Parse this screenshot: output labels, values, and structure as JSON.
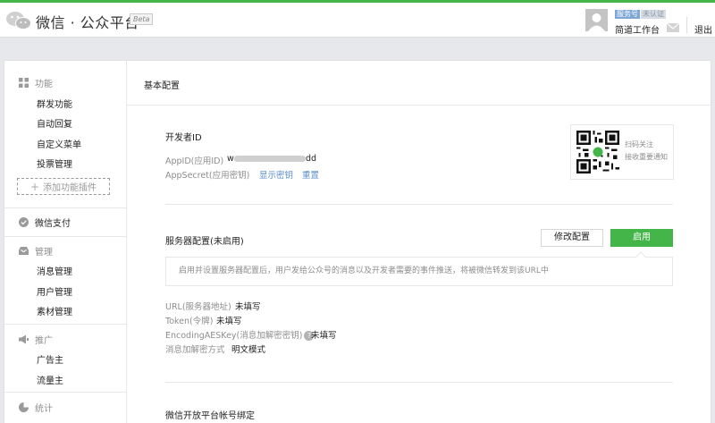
{
  "header": {
    "logo_text": "微信 · 公众平台",
    "beta": "Beta",
    "tag_type": "服务号",
    "tag_status": "未认证",
    "account_name": "简道工作台",
    "logout": "退出"
  },
  "sidebar": {
    "sections": {
      "function": {
        "title": "功能",
        "items": [
          "群发功能",
          "自动回复",
          "自定义菜单",
          "投票管理"
        ]
      },
      "add_plugin": "添加功能插件",
      "pay": {
        "title": "微信支付"
      },
      "manage": {
        "title": "管理",
        "items": [
          "消息管理",
          "用户管理",
          "素材管理"
        ]
      },
      "promote": {
        "title": "推广",
        "items": [
          "广告主",
          "流量主"
        ]
      },
      "stats": {
        "title": "统计"
      }
    }
  },
  "main": {
    "page_title": "基本配置",
    "developer": {
      "title": "开发者ID",
      "appid_label": "AppID(应用ID)",
      "appid_prefix": "w",
      "appid_suffix": "dd",
      "appsecret_label": "AppSecret(应用密钥)",
      "show_secret": "显示密钥",
      "reset": "重置"
    },
    "qr": {
      "line1": "扫码关注",
      "line2": "接收重要通知"
    },
    "server": {
      "title": "服务器配置(未启用)",
      "edit_button": "修改配置",
      "enable_button": "启用",
      "notice": "启用并设置服务器配置后，用户发给公众号的消息以及开发者需要的事件推送，将被微信转发到该URL中",
      "url_label": "URL(服务器地址)",
      "url_value": "未填写",
      "token_label": "Token(令牌)",
      "token_value": "未填写",
      "aes_label": "EncodingAESKey(消息加解密密钥)",
      "aes_help": "?",
      "aes_value": "未填写",
      "mode_label": "消息加解密方式",
      "mode_value": "明文模式"
    },
    "open_platform": {
      "title": "微信开放平台帐号绑定"
    }
  },
  "colors": {
    "accent": "#44b549",
    "link": "#5b8ec9",
    "muted": "#8d8d8d"
  }
}
